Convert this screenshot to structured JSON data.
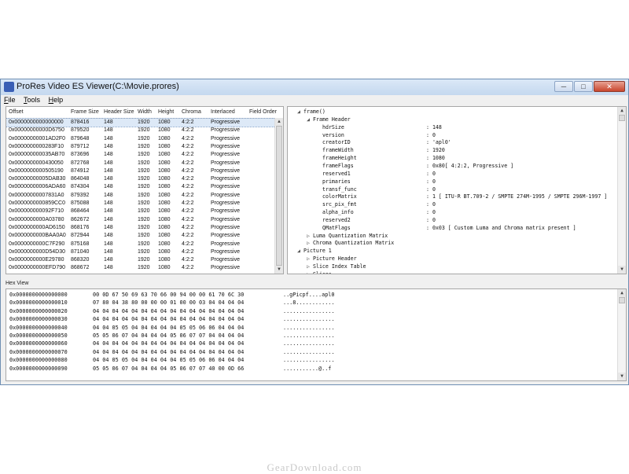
{
  "window": {
    "title": "ProRes Video ES Viewer(C:\\Movie.prores)",
    "buttons": [
      "─",
      "□",
      "✕"
    ]
  },
  "menu": [
    {
      "label": "File",
      "accel": "F",
      "rest": "ile"
    },
    {
      "label": "Tools",
      "accel": "T",
      "rest": "ools"
    },
    {
      "label": "Help",
      "accel": "H",
      "rest": "elp"
    }
  ],
  "list": {
    "columns": [
      "Offset",
      "Frame Size",
      "Header Size",
      "Width",
      "Height",
      "Chroma",
      "Interlaced",
      "Field Order"
    ],
    "rows": [
      [
        "0x0000000000000000",
        "878416",
        "148",
        "1920",
        "1080",
        "4:2:2",
        "Progressive",
        ""
      ],
      [
        "0x00000000000D6750",
        "879520",
        "148",
        "1920",
        "1080",
        "4:2:2",
        "Progressive",
        ""
      ],
      [
        "0x00000000001AD2F0",
        "879648",
        "148",
        "1920",
        "1080",
        "4:2:2",
        "Progressive",
        ""
      ],
      [
        "0x0000000000283F10",
        "879712",
        "148",
        "1920",
        "1080",
        "4:2:2",
        "Progressive",
        ""
      ],
      [
        "0x000000000035AB70",
        "873696",
        "148",
        "1920",
        "1080",
        "4:2:2",
        "Progressive",
        ""
      ],
      [
        "0x0000000000430050",
        "872768",
        "148",
        "1920",
        "1080",
        "4:2:2",
        "Progressive",
        ""
      ],
      [
        "0x0000000000505190",
        "874912",
        "148",
        "1920",
        "1080",
        "4:2:2",
        "Progressive",
        ""
      ],
      [
        "0x00000000005DAB30",
        "864048",
        "148",
        "1920",
        "1080",
        "4:2:2",
        "Progressive",
        ""
      ],
      [
        "0x00000000006ADA60",
        "874304",
        "148",
        "1920",
        "1080",
        "4:2:2",
        "Progressive",
        ""
      ],
      [
        "0x00000000007831A0",
        "879392",
        "148",
        "1920",
        "1080",
        "4:2:2",
        "Progressive",
        ""
      ],
      [
        "0x0000000000859CC0",
        "875088",
        "148",
        "1920",
        "1080",
        "4:2:2",
        "Progressive",
        ""
      ],
      [
        "0x000000000092F710",
        "868464",
        "148",
        "1920",
        "1080",
        "4:2:2",
        "Progressive",
        ""
      ],
      [
        "0x0000000000A03780",
        "862672",
        "148",
        "1920",
        "1080",
        "4:2:2",
        "Progressive",
        ""
      ],
      [
        "0x0000000000AD6150",
        "868176",
        "148",
        "1920",
        "1080",
        "4:2:2",
        "Progressive",
        ""
      ],
      [
        "0x0000000000BAA0A0",
        "872944",
        "148",
        "1920",
        "1080",
        "4:2:2",
        "Progressive",
        ""
      ],
      [
        "0x0000000000C7F290",
        "875168",
        "148",
        "1920",
        "1080",
        "4:2:2",
        "Progressive",
        ""
      ],
      [
        "0x0000000000D54D30",
        "871040",
        "148",
        "1920",
        "1080",
        "4:2:2",
        "Progressive",
        ""
      ],
      [
        "0x0000000000E29780",
        "868320",
        "148",
        "1920",
        "1080",
        "4:2:2",
        "Progressive",
        ""
      ],
      [
        "0x0000000000EFD790",
        "868672",
        "148",
        "1920",
        "1080",
        "4:2:2",
        "Progressive",
        ""
      ]
    ]
  },
  "tree": [
    {
      "level": 0,
      "exp": "◢",
      "label": "frame()",
      "value": ""
    },
    {
      "level": 1,
      "exp": "◢",
      "label": "Frame Header",
      "value": ""
    },
    {
      "level": 2,
      "exp": "",
      "label": "hdrSize",
      "value": ": 148"
    },
    {
      "level": 2,
      "exp": "",
      "label": "version",
      "value": ": 0"
    },
    {
      "level": 2,
      "exp": "",
      "label": "creatorID",
      "value": ": 'apl0'"
    },
    {
      "level": 2,
      "exp": "",
      "label": "frameWidth",
      "value": ": 1920"
    },
    {
      "level": 2,
      "exp": "",
      "label": "frameHeight",
      "value": ": 1080"
    },
    {
      "level": 2,
      "exp": "",
      "label": "frameFlags",
      "value": ": 0x80[ 4:2:2, Progressive ]"
    },
    {
      "level": 2,
      "exp": "",
      "label": "reserved1",
      "value": ": 0"
    },
    {
      "level": 2,
      "exp": "",
      "label": "primaries",
      "value": ": 0"
    },
    {
      "level": 2,
      "exp": "",
      "label": "transf_func",
      "value": ": 0"
    },
    {
      "level": 2,
      "exp": "",
      "label": "colorMatrix",
      "value": ": 1 [ ITU-R BT.709-2 / SMPTE 274M-1995 / SMPTE 296M-1997 ]"
    },
    {
      "level": 2,
      "exp": "",
      "label": "src_pix_fmt",
      "value": ": 0"
    },
    {
      "level": 2,
      "exp": "",
      "label": "alpha_info",
      "value": ": 0"
    },
    {
      "level": 2,
      "exp": "",
      "label": "reserved2",
      "value": ": 0"
    },
    {
      "level": 2,
      "exp": "",
      "label": "QMatFlags",
      "value": ": 0x03 [ Custom Luma and Chroma matrix present ]"
    },
    {
      "level": 1,
      "exp": "▷",
      "label": "Luma Quantization Matrix",
      "value": ""
    },
    {
      "level": 1,
      "exp": "▷",
      "label": "Chroma Quantization Matrix",
      "value": ""
    },
    {
      "level": 0,
      "exp": "◢",
      "label": "Picture 1",
      "value": ""
    },
    {
      "level": 1,
      "exp": "▷",
      "label": "Picture Header",
      "value": ""
    },
    {
      "level": 1,
      "exp": "▷",
      "label": "Slice Index Table",
      "value": ""
    },
    {
      "level": 1,
      "exp": "▷",
      "label": "Slices",
      "value": ""
    }
  ],
  "hex": {
    "label": "Hex View",
    "rows": [
      {
        "offset": "0x0000000000000000",
        "bytes": "00 0D 67 50 69 63 70 66 00 94 00 00 61 70 6C 30",
        "ascii": "..gPicpf....apl0"
      },
      {
        "offset": "0x0000000000000010",
        "bytes": "07 80 04 38 80 00 00 00 01 00 00 03 04 04 04 04",
        "ascii": "...8............"
      },
      {
        "offset": "0x0000000000000020",
        "bytes": "04 04 04 04 04 04 04 04 04 04 04 04 04 04 04 04",
        "ascii": "................"
      },
      {
        "offset": "0x0000000000000030",
        "bytes": "04 04 04 04 04 04 04 04 04 04 04 04 04 04 04 04",
        "ascii": "................"
      },
      {
        "offset": "0x0000000000000040",
        "bytes": "04 04 05 05 04 04 04 04 04 05 05 06 06 04 04 04",
        "ascii": "................"
      },
      {
        "offset": "0x0000000000000050",
        "bytes": "05 05 06 07 04 04 04 04 05 06 07 07 04 04 04 04",
        "ascii": "................"
      },
      {
        "offset": "0x0000000000000060",
        "bytes": "04 04 04 04 04 04 04 04 04 04 04 04 04 04 04 04",
        "ascii": "................"
      },
      {
        "offset": "0x0000000000000070",
        "bytes": "04 04 04 04 04 04 04 04 04 04 04 04 04 04 04 04",
        "ascii": "................"
      },
      {
        "offset": "0x0000000000000080",
        "bytes": "04 04 05 05 04 04 04 04 04 05 05 06 06 04 04 04",
        "ascii": "................"
      },
      {
        "offset": "0x0000000000000090",
        "bytes": "05 05 06 07 04 04 04 04 05 06 07 07 40 00 0D 66",
        "ascii": "...........@..f"
      }
    ]
  },
  "watermark": "GearDownload.com"
}
